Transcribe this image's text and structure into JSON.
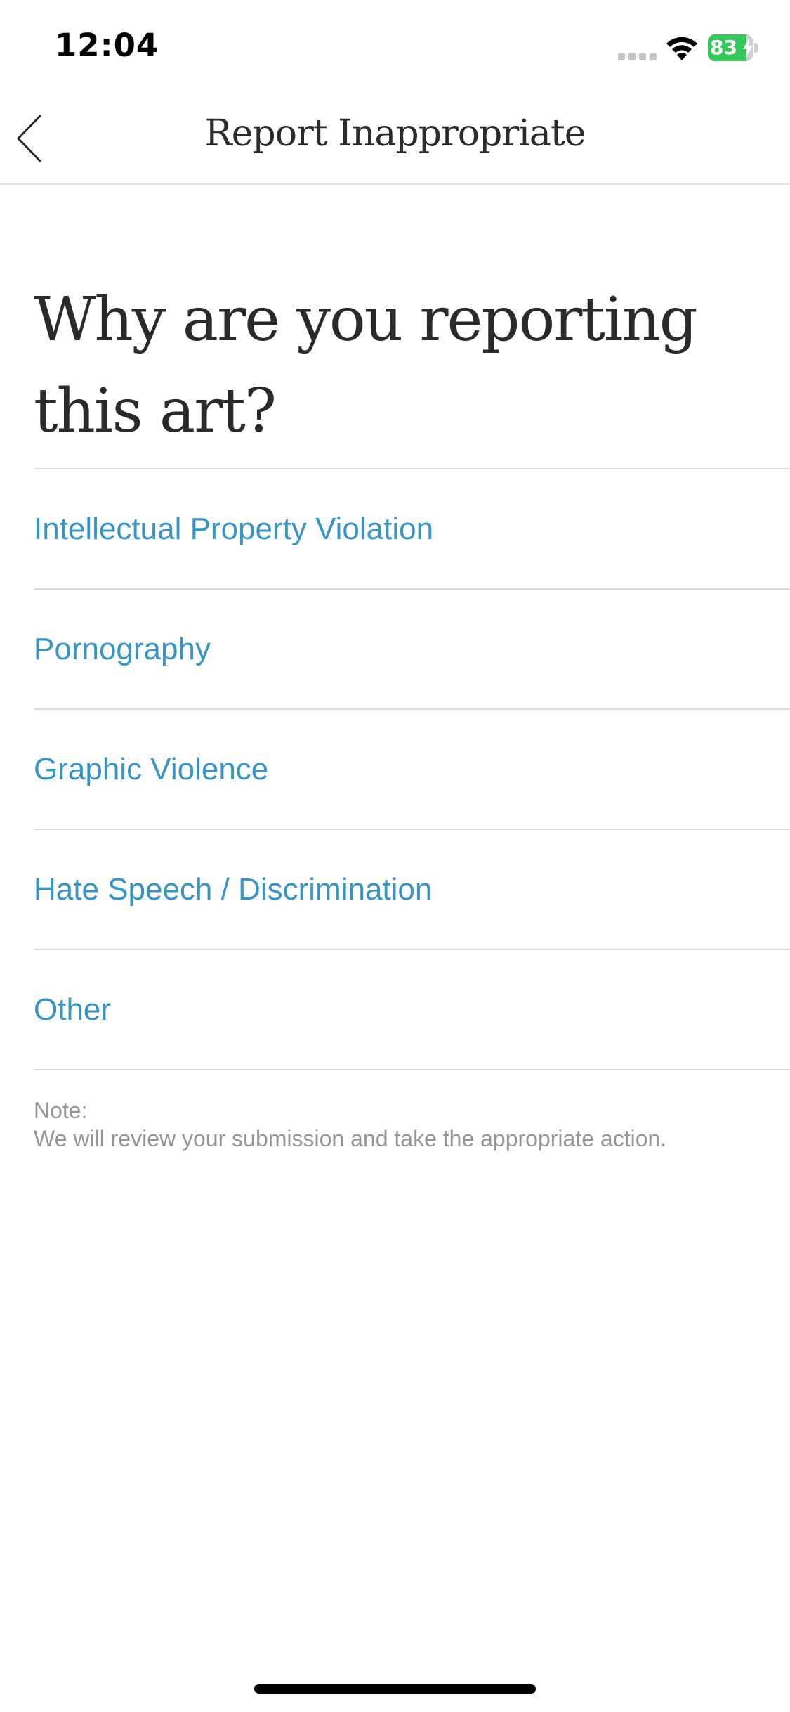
{
  "status_bar": {
    "time": "12:04",
    "battery_level": "83",
    "battery_charging": true
  },
  "nav": {
    "title": "Report Inappropriate",
    "back_icon": "chevron-left-icon"
  },
  "page": {
    "heading": "Why are you reporting this art?"
  },
  "reasons": [
    {
      "label": "Intellectual Property Violation"
    },
    {
      "label": "Pornography"
    },
    {
      "label": "Graphic Violence"
    },
    {
      "label": "Hate Speech / Discrimination"
    },
    {
      "label": "Other"
    }
  ],
  "note": {
    "title": "Note:",
    "text": "We will review your submission and take the appropriate action."
  },
  "colors": {
    "link": "#3894c4",
    "heading": "#2a2a2a",
    "note": "#959595",
    "divider": "#dcdcdc",
    "battery": "#34c759"
  }
}
